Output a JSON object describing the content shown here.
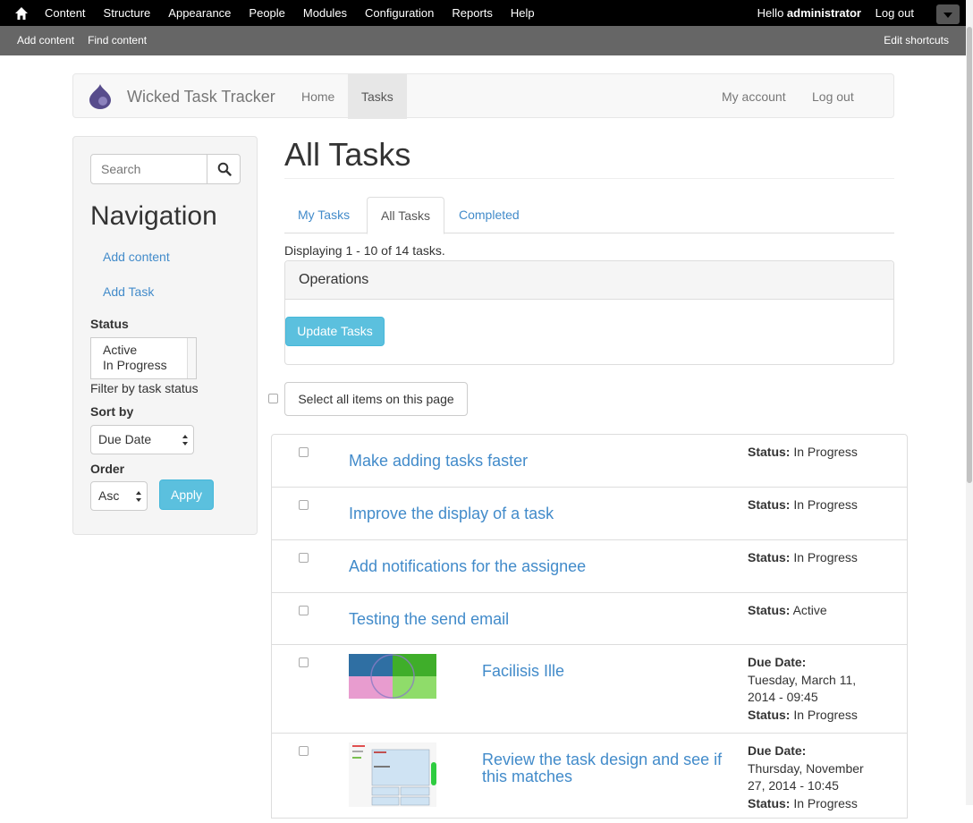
{
  "admin_toolbar": {
    "home_icon": "home-icon",
    "menu": [
      "Content",
      "Structure",
      "Appearance",
      "People",
      "Modules",
      "Configuration",
      "Reports",
      "Help"
    ],
    "hello": "Hello",
    "username": "administrator",
    "logout": "Log out"
  },
  "shortcuts": {
    "add_content": "Add content",
    "find_content": "Find content",
    "edit_shortcuts": "Edit shortcuts"
  },
  "site": {
    "name": "Wicked Task Tracker",
    "nav": [
      "Home",
      "Tasks"
    ],
    "active_nav": "Tasks",
    "account": "My account",
    "logout": "Log out"
  },
  "sidebar": {
    "search_placeholder": "Search",
    "nav_title": "Navigation",
    "links": [
      "Add content",
      "Add Task"
    ],
    "status_label": "Status",
    "status_options": [
      "Active",
      "In Progress"
    ],
    "status_hint": "Filter by task status",
    "sort_label": "Sort by",
    "sort_value": "Due Date",
    "order_label": "Order",
    "order_value": "Asc",
    "apply": "Apply"
  },
  "main": {
    "title": "All Tasks",
    "tabs": [
      "My Tasks",
      "All Tasks",
      "Completed"
    ],
    "active_tab": "All Tasks",
    "displaying": "Displaying 1 - 10 of 14 tasks.",
    "operations_title": "Operations",
    "update_button": "Update Tasks",
    "select_all": "Select all items on this page"
  },
  "tasks": [
    {
      "title": "Make adding tasks faster",
      "status_label": "Status:",
      "status": "In Progress"
    },
    {
      "title": "Improve the display of a task",
      "status_label": "Status:",
      "status": "In Progress"
    },
    {
      "title": "Add notifications for the assignee",
      "status_label": "Status:",
      "status": "In Progress"
    },
    {
      "title": "Testing the send email",
      "status_label": "Status:",
      "status": "Active"
    },
    {
      "title": "Facilisis Ille",
      "due_label": "Due Date:",
      "due": "Tuesday, March 11, 2014 - 09:45",
      "status_label": "Status:",
      "status": "In Progress"
    },
    {
      "title": "Review the task design and see if this matches",
      "due_label": "Due Date:",
      "due": "Thursday, November 27, 2014 - 10:45",
      "status_label": "Status:",
      "status": "In Progress"
    }
  ],
  "colors": {
    "link": "#428bca",
    "info_button": "#5bc0de",
    "toolbar": "#000000",
    "shortcuts": "#666666"
  }
}
